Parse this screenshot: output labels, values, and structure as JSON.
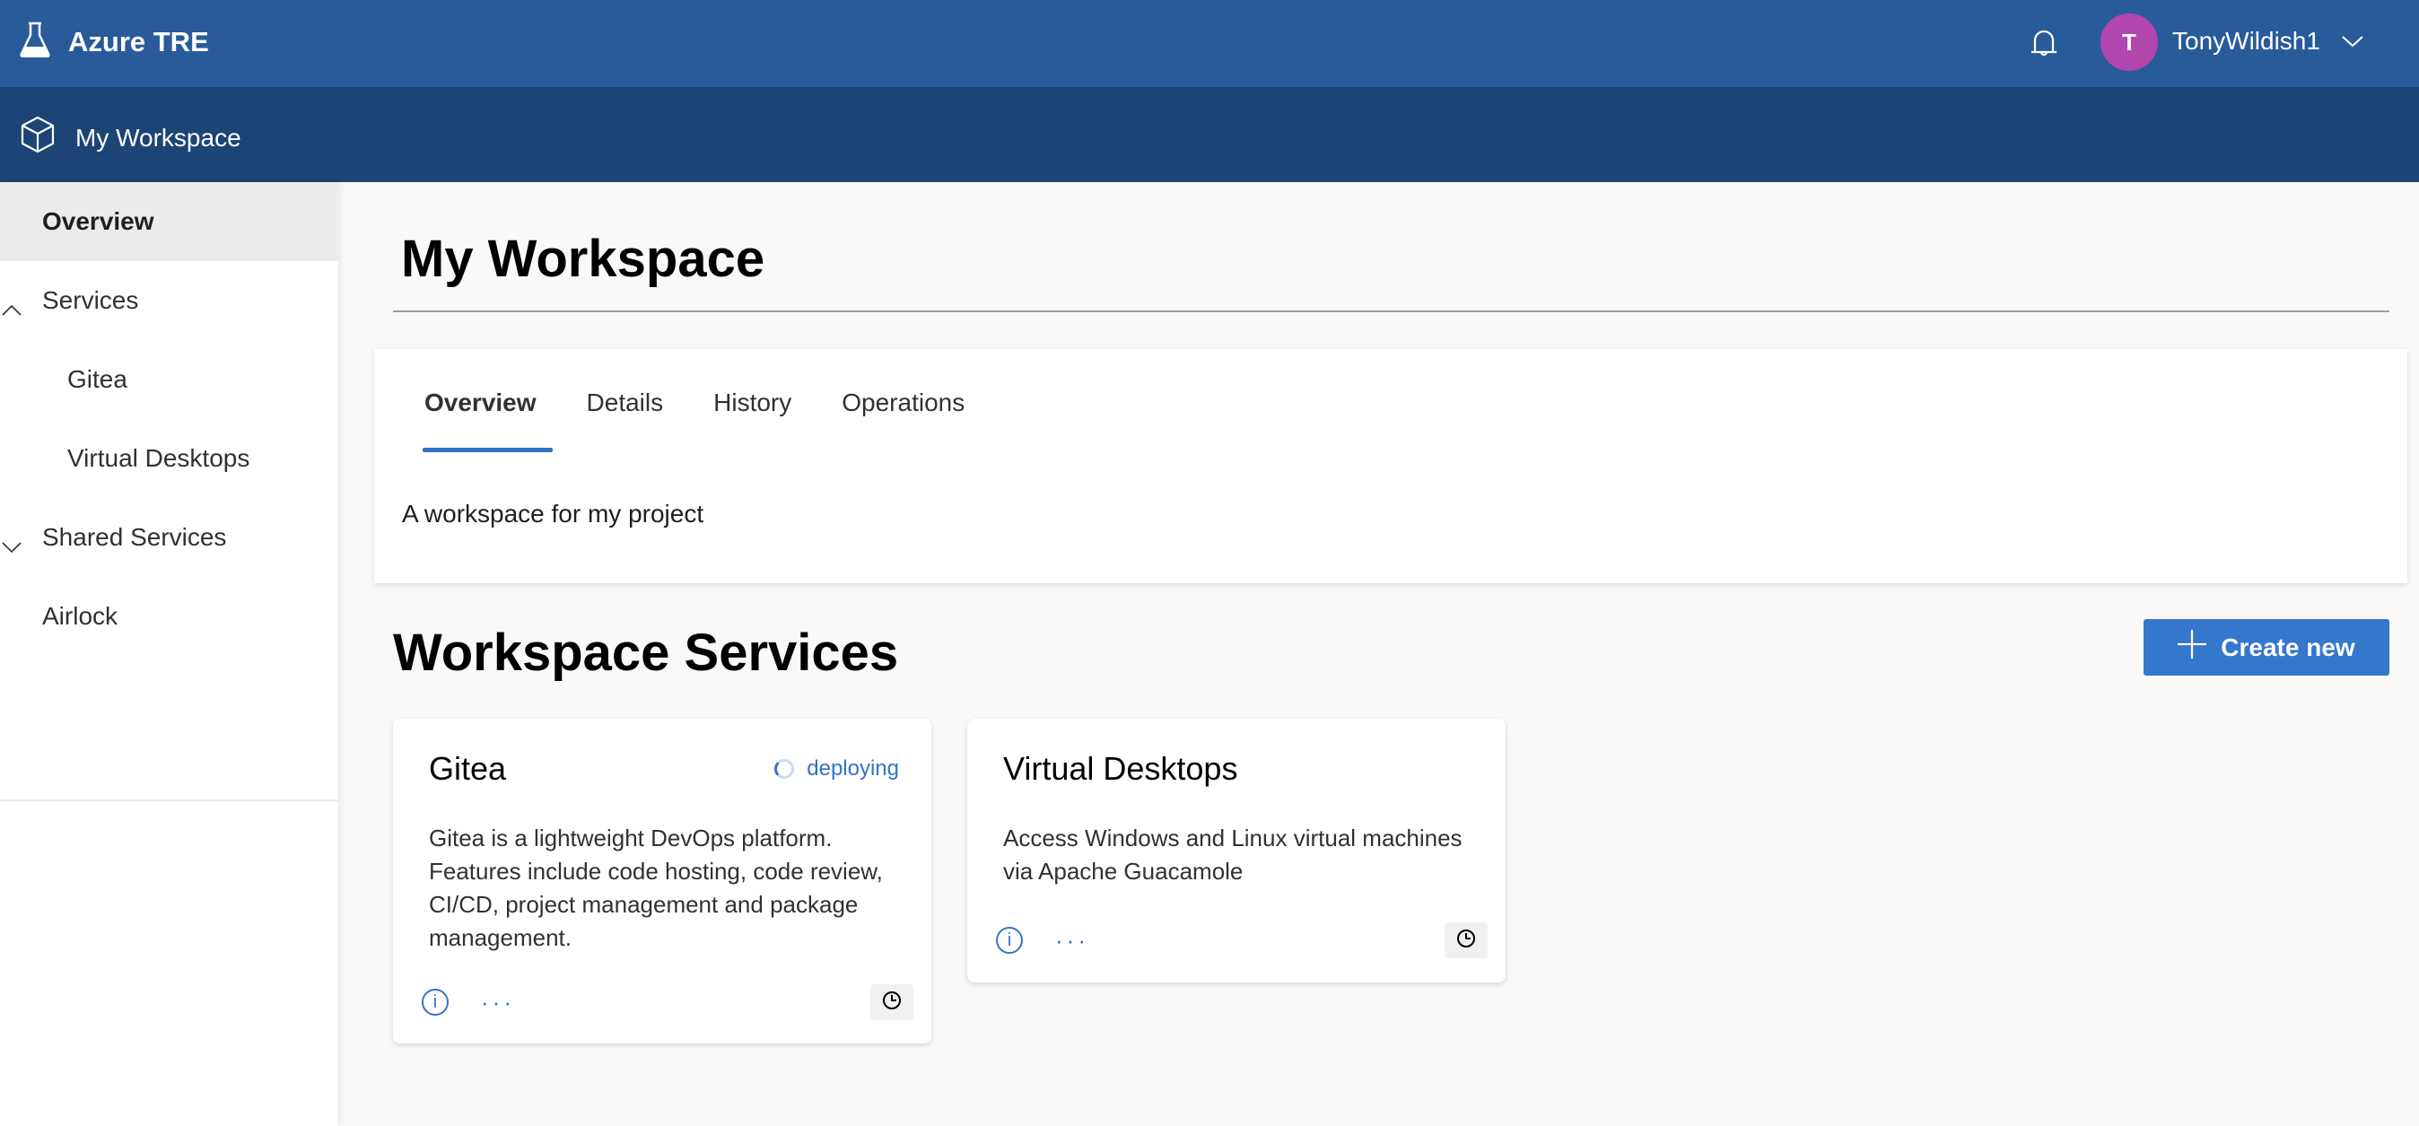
{
  "header": {
    "app_title": "Azure TRE",
    "logo_icon": "flask-icon",
    "notifications_icon": "bell-icon",
    "user": {
      "initial": "T",
      "name": "TonyWildish1",
      "avatar_color": "#b146ad"
    }
  },
  "subheader": {
    "workspace_name": "My Workspace",
    "icon": "cube-icon"
  },
  "sidebar": {
    "items": [
      {
        "label": "Overview",
        "selected": true
      },
      {
        "label": "Services",
        "expanded": true
      },
      {
        "label": "Gitea",
        "child": true
      },
      {
        "label": "Virtual Desktops",
        "child": true
      },
      {
        "label": "Shared Services",
        "expanded": false
      },
      {
        "label": "Airlock"
      }
    ]
  },
  "main": {
    "title": "My Workspace",
    "tabs": [
      {
        "label": "Overview",
        "active": true
      },
      {
        "label": "Details"
      },
      {
        "label": "History"
      },
      {
        "label": "Operations"
      }
    ],
    "description": "A workspace for my project",
    "services_title": "Workspace Services",
    "create_label": "Create new",
    "services": [
      {
        "name": "Gitea",
        "status": "deploying",
        "description": "Gitea is a lightweight DevOps platform. Features include code hosting, code review, CI/CD, project management and package management."
      },
      {
        "name": "Virtual Desktops",
        "status": "",
        "description": "Access Windows and Linux virtual machines via Apache Guacamole"
      }
    ]
  },
  "colors": {
    "topbar": "#295b9b",
    "subbar": "#1c4475",
    "accent": "#3274c8",
    "button": "#3477cc"
  }
}
